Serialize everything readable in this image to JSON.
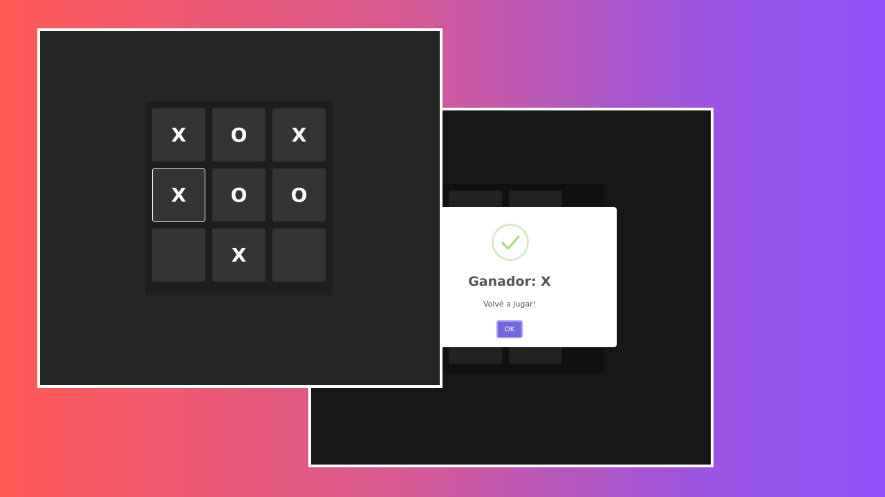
{
  "front_board": {
    "cells": [
      "X",
      "O",
      "X",
      "X",
      "O",
      "O",
      "",
      "X",
      ""
    ],
    "active_index": 3
  },
  "back_board": {
    "cells": [
      "",
      "",
      "",
      "",
      "",
      "",
      "",
      "",
      ""
    ]
  },
  "modal": {
    "icon": "check-icon",
    "title": "Ganador: X",
    "text": "Volvé a jugar!",
    "ok_label": "OK",
    "accent": "#7367e0",
    "check_color": "#a5dc86"
  },
  "colors": {
    "gradient_start": "#ff5a55",
    "gradient_end": "#8f52f7",
    "board_bg": "#252525"
  }
}
